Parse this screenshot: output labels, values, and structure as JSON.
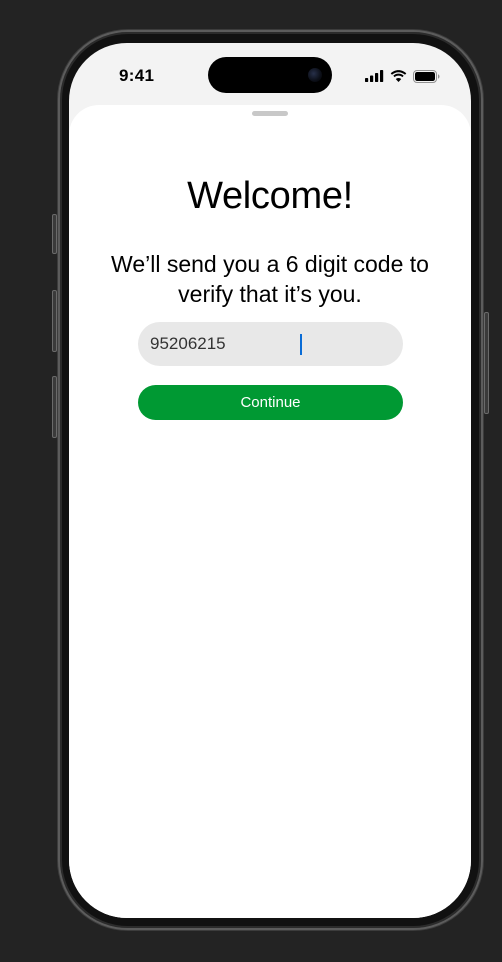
{
  "status_bar": {
    "time": "9:41",
    "icons": [
      "cellular-signal-icon",
      "wifi-icon",
      "battery-icon"
    ]
  },
  "welcome": {
    "title": "Welcome!",
    "subtitle": "We’ll send you a 6 digit code to verify that it’s you."
  },
  "code_field": {
    "value": "95206215"
  },
  "continue_button": {
    "label": "Continue"
  },
  "colors": {
    "accent_green": "#009933",
    "input_background": "#e8e8e8",
    "caret": "#0a6cd6"
  }
}
